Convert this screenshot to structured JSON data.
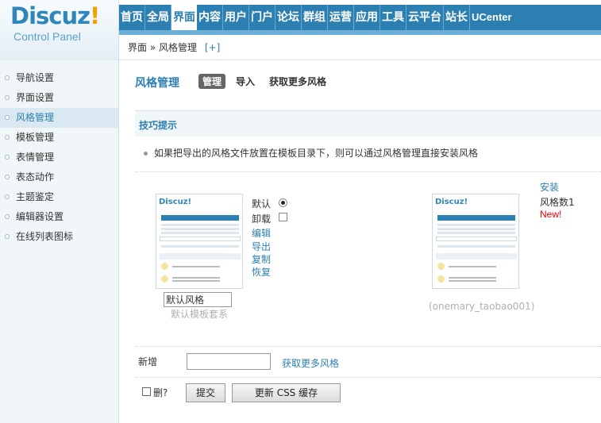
{
  "logo": {
    "brand_main": "Discuz",
    "brand_mark": "!",
    "subtitle": "Control Panel"
  },
  "topnav": {
    "items": [
      "首页",
      "全局",
      "界面",
      "内容",
      "用户",
      "门户",
      "论坛",
      "群组",
      "运营",
      "应用",
      "工具",
      "云平台",
      "站长",
      "UCenter"
    ],
    "active_index": 2
  },
  "breadcrumb": {
    "parent": "界面",
    "separator": "»",
    "current": "风格管理",
    "add": "[+]"
  },
  "sidebar": {
    "items": [
      "导航设置",
      "界面设置",
      "风格管理",
      "模板管理",
      "表情管理",
      "表态动作",
      "主题鉴定",
      "编辑器设置",
      "在线列表图标"
    ],
    "active_index": 2
  },
  "main": {
    "title": "风格管理",
    "tabs": [
      "管理",
      "导入",
      "获取更多风格"
    ],
    "active_tab": 0,
    "tips_title": "技巧提示",
    "tip": "如果把导出的风格文件放置在模板目录下，则可以通过风格管理直接安装风格"
  },
  "styles": [
    {
      "name_value": "默认风格",
      "description": "默认模板套系",
      "radio_label": "默认",
      "uninstall_label": "卸载",
      "actions": [
        "编辑",
        "导出",
        "复制",
        "恢复"
      ],
      "thumb_brand": "Discuz!"
    },
    {
      "description": "(onemary_taobao001)",
      "install": "安装",
      "count_label": "风格数1",
      "new_badge": "New!",
      "thumb_brand": "Discuz!"
    }
  ],
  "add": {
    "label": "新增",
    "more": "获取更多风格"
  },
  "footer": {
    "delete_label": "删?",
    "submit": "提交",
    "refresh_cache": "更新 CSS 缓存"
  }
}
